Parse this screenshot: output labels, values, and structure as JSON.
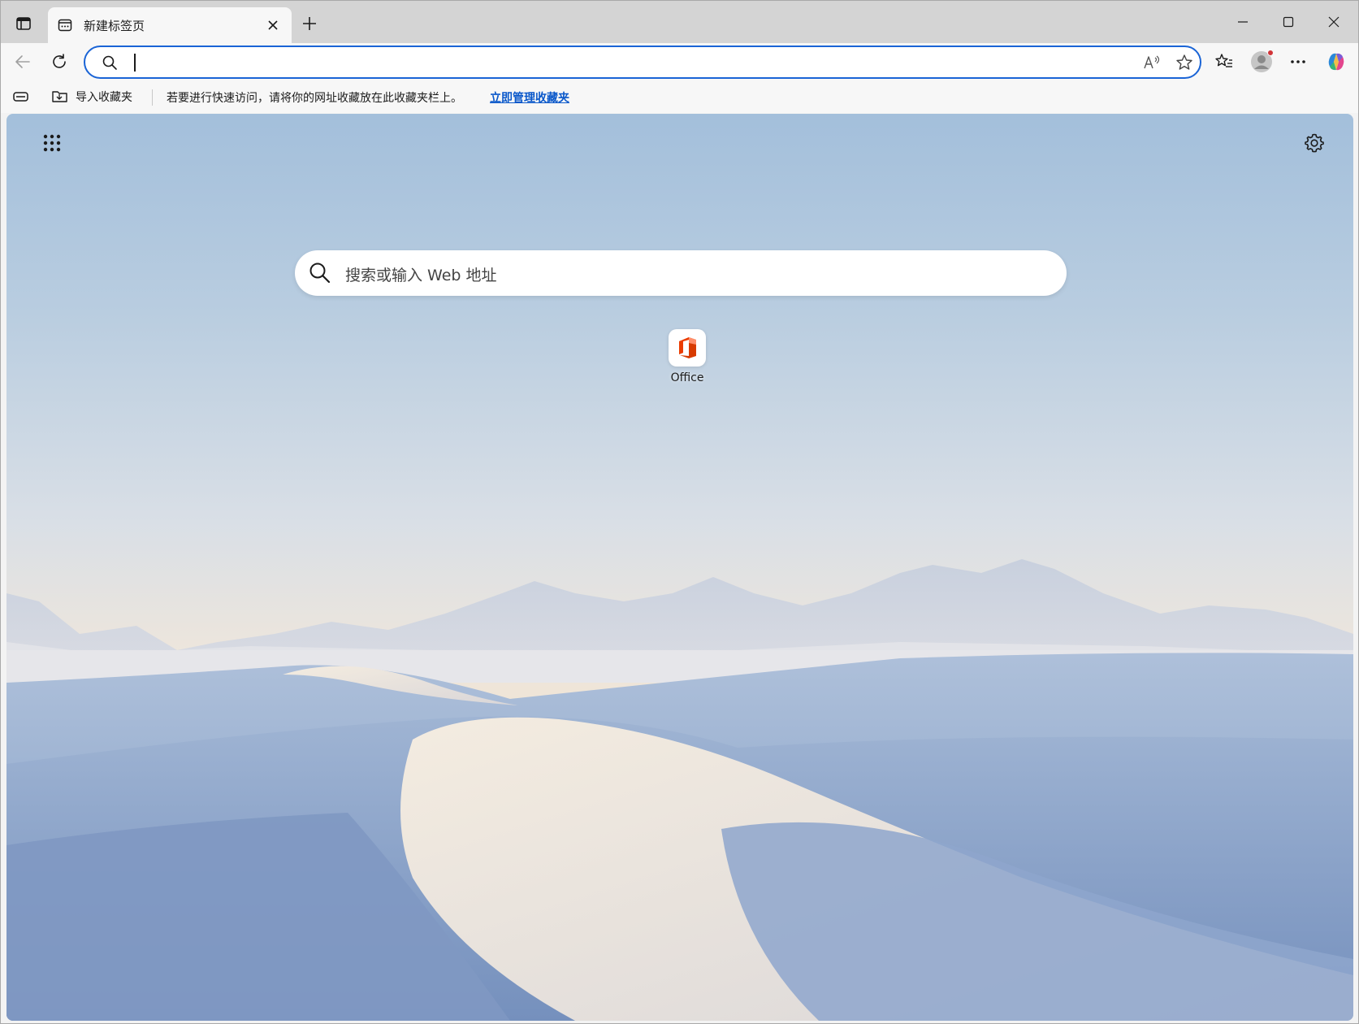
{
  "tabstrip": {
    "tab_title": "新建标签页"
  },
  "toolbar": {
    "address_value": "",
    "address_placeholder": ""
  },
  "favorites_bar": {
    "import_label": "导入收藏夹",
    "hint_text": "若要进行快速访问，请将你的网址收藏放在此收藏夹栏上。",
    "manage_link": "立即管理收藏夹"
  },
  "ntp": {
    "search_placeholder": "搜索或输入 Web 地址",
    "quick_links": [
      {
        "label": "Office",
        "icon": "office-icon"
      }
    ]
  },
  "colors": {
    "accent": "#1a64d6",
    "link": "#0a58ca",
    "notification_dot": "#d13438",
    "office_red": "#d83b01"
  }
}
